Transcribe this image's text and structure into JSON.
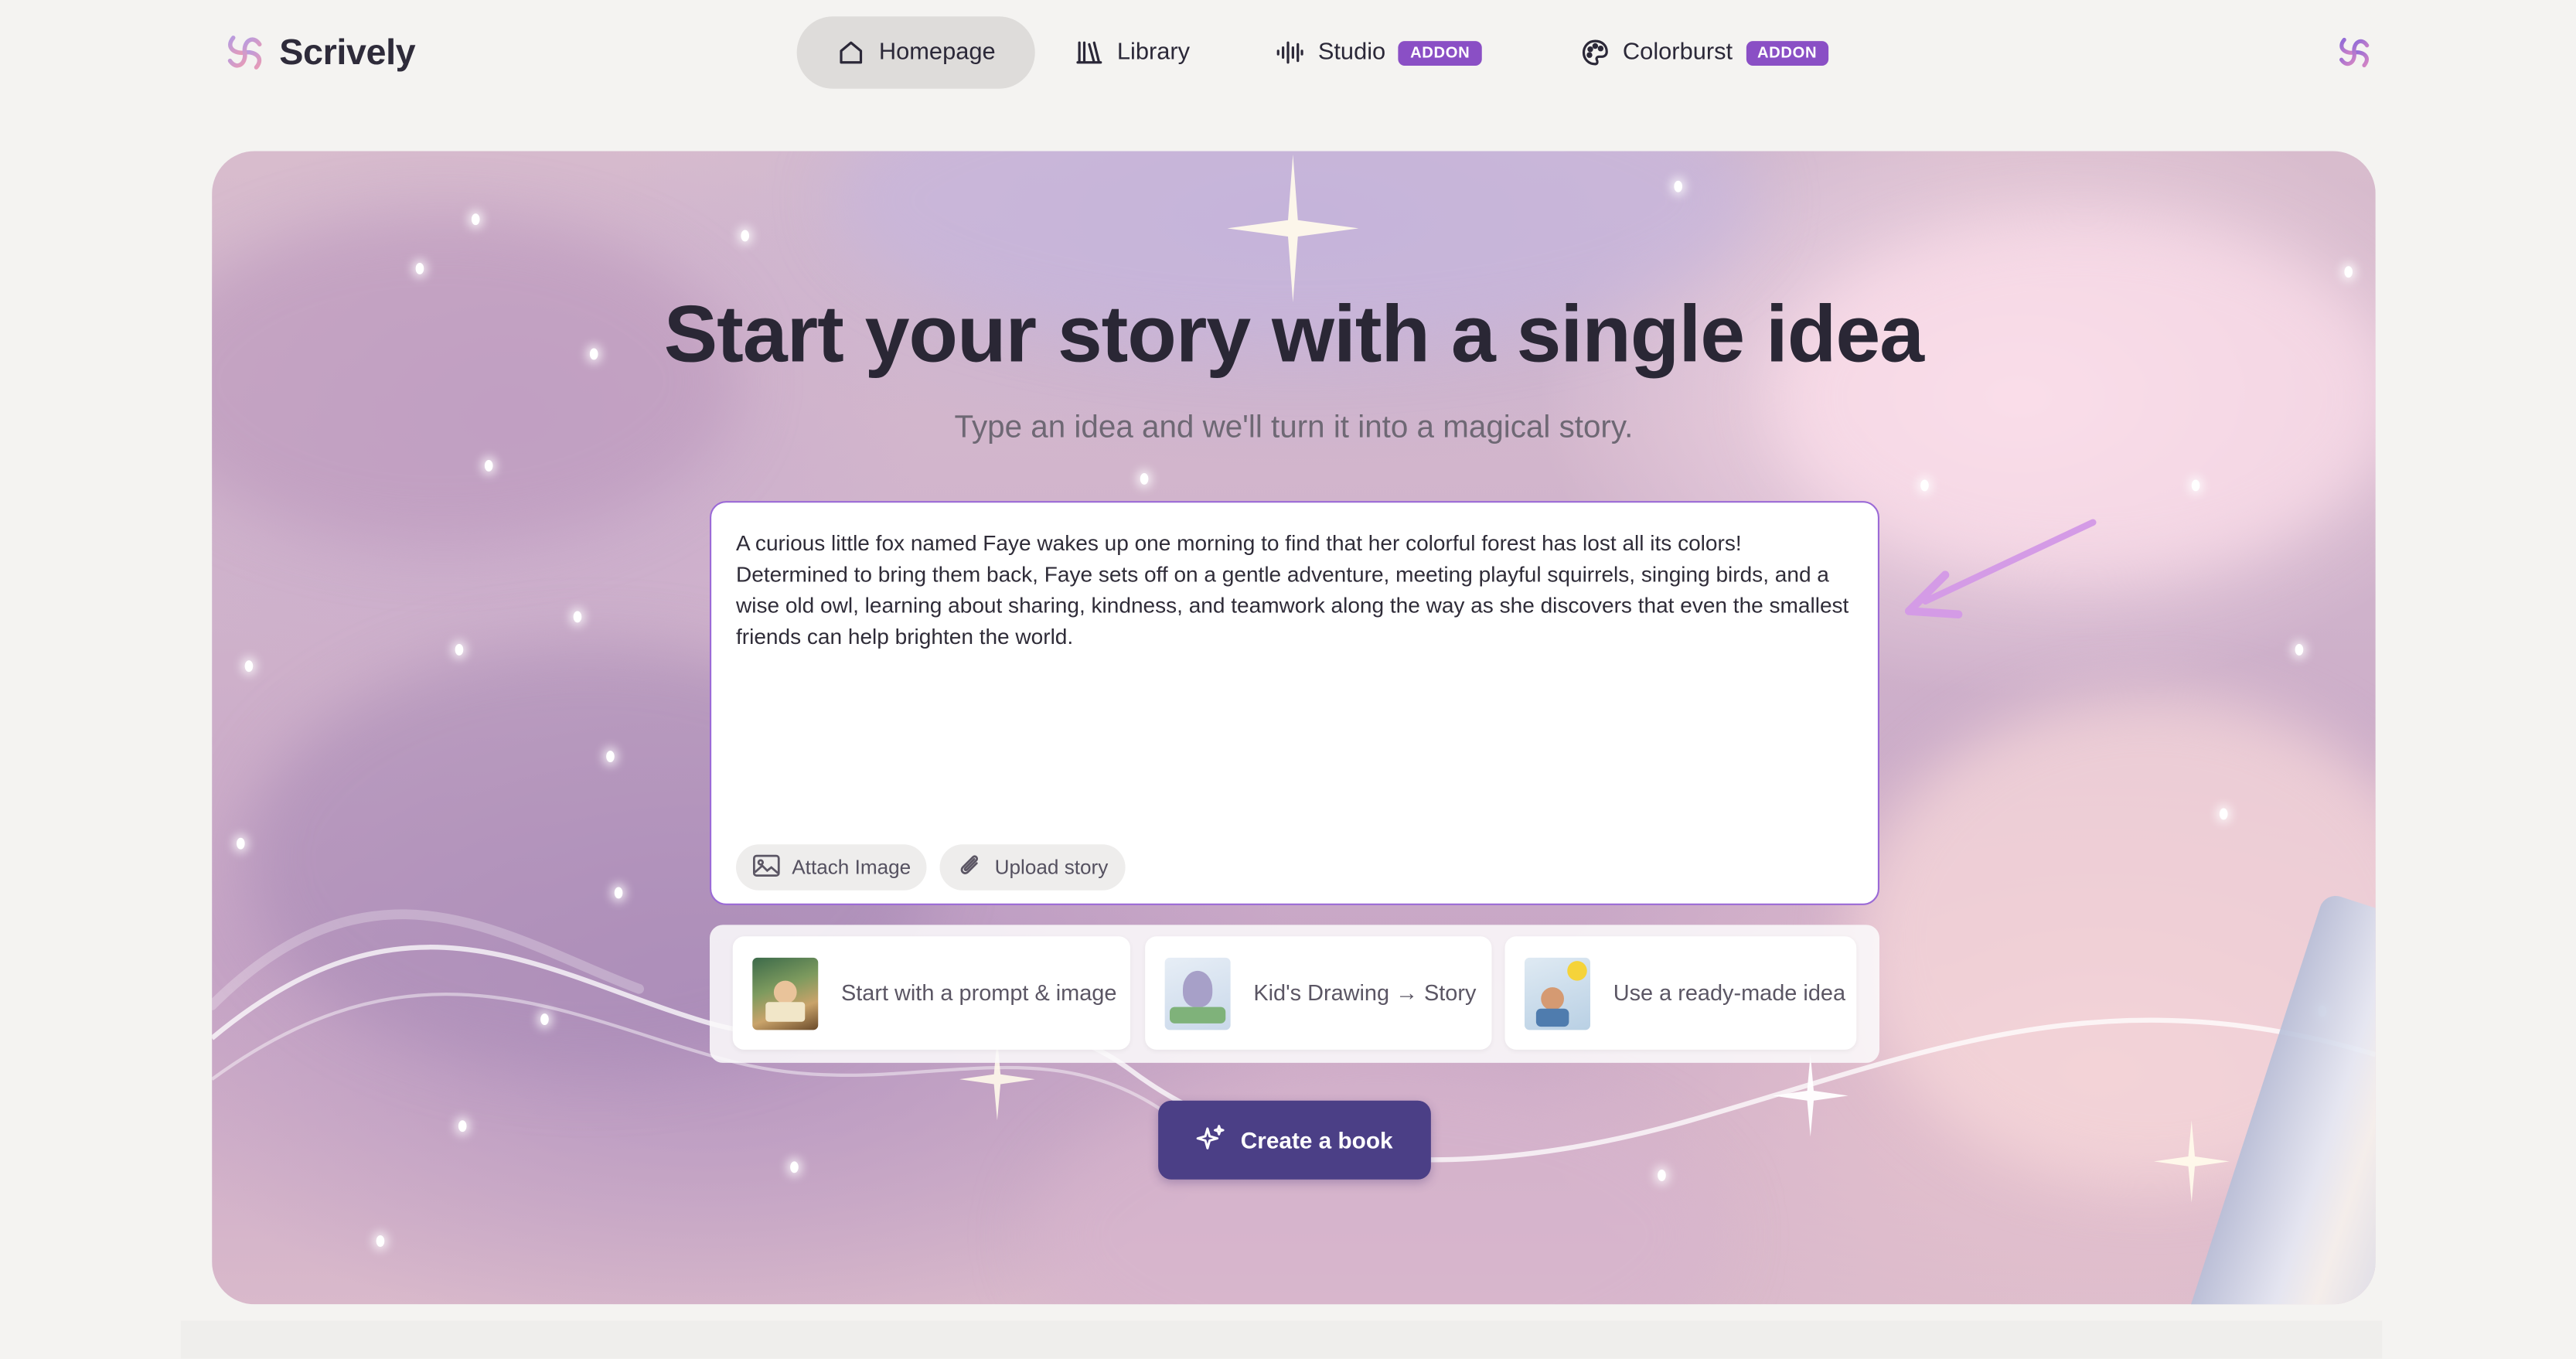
{
  "brand": {
    "name": "Scrively",
    "accent": "#8a4fc5",
    "button_color": "#4b3f86"
  },
  "nav": {
    "items": [
      {
        "label": "Homepage",
        "icon": "home-icon",
        "active": true
      },
      {
        "label": "Library",
        "icon": "library-icon"
      },
      {
        "label": "Studio",
        "icon": "waveform-icon",
        "badge": "ADDON"
      },
      {
        "label": "Colorburst",
        "icon": "palette-icon",
        "badge": "ADDON"
      }
    ]
  },
  "hero": {
    "title": "Start your story with a single idea",
    "subtitle": "Type an idea and we'll turn it into a magical story."
  },
  "prompt": {
    "value": "A curious little fox named Faye wakes up one morning to find that her colorful forest has lost all its colors! Determined to bring them back, Faye sets off on a gentle adventure, meeting playful squirrels, singing birds, and a wise old owl, learning about sharing, kindness, and teamwork along the way as she discovers that even the smallest friends can help brighten the world.",
    "attach_image": "Attach Image",
    "upload_story": "Upload story"
  },
  "suggestions": [
    {
      "label": "Start with a prompt & image"
    },
    {
      "label": "Kid's Drawing → Story"
    },
    {
      "label": "Use a ready-made idea"
    }
  ],
  "cta": {
    "label": "Create a book",
    "icon": "sparkles-icon"
  }
}
